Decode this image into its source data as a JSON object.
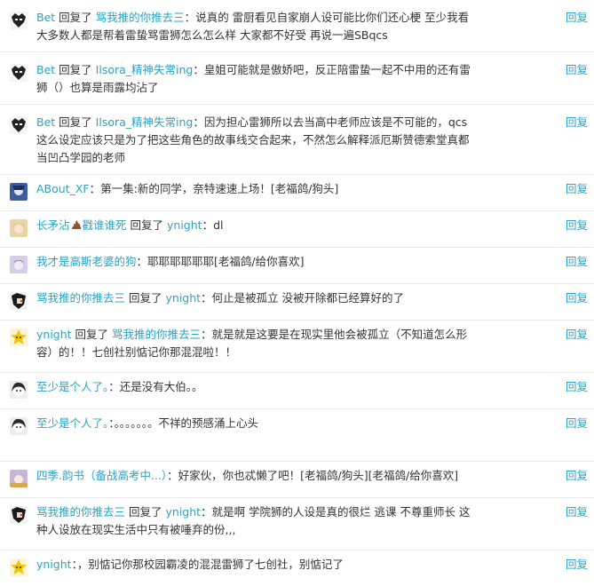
{
  "reply_label": "回复",
  "items": [
    {
      "avatar": "bw-face",
      "user": "Bet",
      "replied_label": "回复了",
      "target": "骂我推的你推去三",
      "sep": "：",
      "content": "说真的 雷厨看见自家崩人设可能比你们还心梗 至少我看大多数人都是帮着雷蛰骂雷狮怎么怎么样 大家都不好受 再说一遍SBqcs"
    },
    {
      "avatar": "bw-face",
      "user": "Bet",
      "replied_label": "回复了",
      "target": "Ilsora_精神失常ing",
      "sep": "：",
      "content": "皇姐可能就是傲娇吧，反正陪雷蛰一起不中用的还有雷狮（）也算是雨露均沾了"
    },
    {
      "avatar": "bw-face",
      "user": "Bet",
      "replied_label": "回复了",
      "target": "Ilsora_精神失常ing",
      "sep": "：",
      "content": "因为担心雷狮所以去当高中老师应该是不可能的，qcs这么设定应该只是为了把这些角色的故事线交合起来，不然怎么解释派厄斯赞德索堂真都当凹凸学园的老师"
    },
    {
      "avatar": "blue-anime",
      "user": "ABout_XF",
      "replied_label": "",
      "target": "",
      "sep": "：",
      "content": "第一集:新的同学，奈特速速上场！[老福鸽/狗头]"
    },
    {
      "avatar": "blonde-anime",
      "user": "长矛沾",
      "has_poop_emoji": true,
      "user_suffix": "戳谁谁死",
      "replied_label": "回复了",
      "target": "ynight",
      "sep": "：",
      "content": "dl"
    },
    {
      "avatar": "purple-anime",
      "user": "我才是高斯老婆的狗",
      "replied_label": "",
      "target": "",
      "sep": "：",
      "content": "耶耶耶耶耶耶[老福鸽/给你喜欢]"
    },
    {
      "avatar": "dark-anime",
      "user": "骂我推的你推去三",
      "replied_label": "回复了",
      "target": "ynight",
      "sep": "：",
      "content": "何止是被孤立 没被开除都已经算好的了"
    },
    {
      "avatar": "yellow-star",
      "user": "ynight",
      "replied_label": "回复了",
      "target": "骂我推的你推去三",
      "sep": "：",
      "content": "就是就是这要是在现实里他会被孤立（不知道怎么形容）的！！七创社别惦记你那混混啦！！"
    },
    {
      "avatar": "bw-girl",
      "user": "至少是个人了。",
      "replied_label": "",
      "target": "",
      "sep": "：",
      "content": "还是没有大伯。。"
    },
    {
      "avatar": "bw-girl",
      "user": "至少是个人了。",
      "replied_label": "",
      "target": "",
      "sep": "：",
      "content": "。。。。。。。不祥的预感涌上心头"
    },
    {
      "avatar": "colorful-anime",
      "user": "四季.韵书（备战高考中...）",
      "replied_label": "",
      "target": "",
      "sep": "：",
      "content": "好家伙，你也忒懒了吧！[老福鸽/狗头][老福鸽/给你喜欢]"
    },
    {
      "avatar": "dark-anime",
      "user": "骂我推的你推去三",
      "replied_label": "回复了",
      "target": "ynight",
      "sep": "：",
      "content": "就是啊 学院狮的人设是真的很烂 逃课 不尊重师长 这种人设放在现实生活中只有被唾弃的份,,,"
    },
    {
      "avatar": "yellow-star",
      "user": "ynight",
      "replied_label": "",
      "target": "",
      "sep": "：",
      "content": "，别惦记你那校园霸凌的混混雷狮了七创社，别惦记了"
    }
  ],
  "colors": {
    "link": "#2aa3c4",
    "text": "#333333",
    "divider": "#e8e8e8"
  }
}
